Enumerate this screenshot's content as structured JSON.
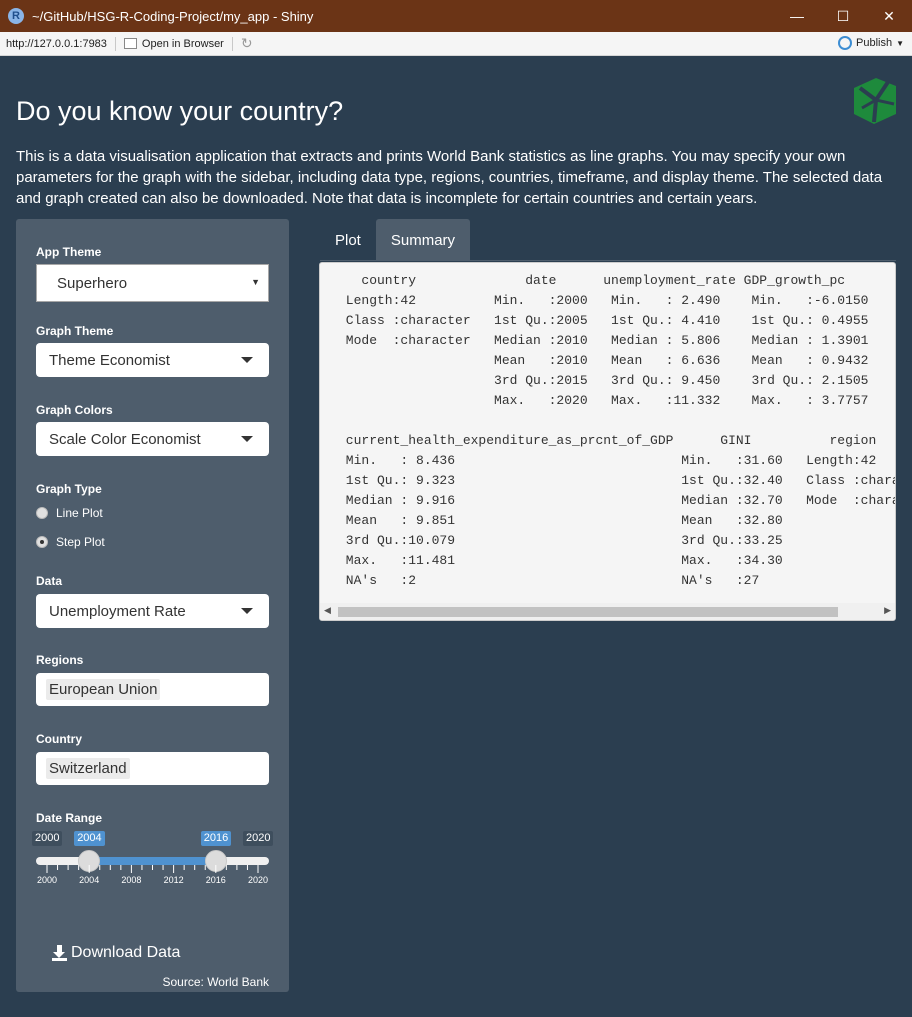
{
  "window": {
    "title": "~/GitHub/HSG-R-Coding-Project/my_app - Shiny",
    "minimize_glyph": "—",
    "maximize_glyph": "☐",
    "close_glyph": "✕"
  },
  "addressbar": {
    "url": "http://127.0.0.1:7983",
    "open_in_browser": "Open in Browser",
    "publish": "Publish"
  },
  "page": {
    "title": "Do you know your country?",
    "intro": "This is a data visualisation application that extracts and prints World Bank statistics as line graphs. You may specify your own parameters for the graph with the sidebar, including data type, regions, countries, timeframe, and display theme. The selected data and graph created can also be downloaded. Note that data is incomplete for certain countries and certain years."
  },
  "sidebar": {
    "app_theme": {
      "label": "App Theme",
      "value": "Superhero"
    },
    "graph_theme": {
      "label": "Graph Theme",
      "value": "Theme Economist"
    },
    "graph_colors": {
      "label": "Graph Colors",
      "value": "Scale Color Economist"
    },
    "graph_type": {
      "label": "Graph Type",
      "options": [
        "Line Plot",
        "Step Plot"
      ],
      "selected": "Step Plot"
    },
    "data": {
      "label": "Data",
      "value": "Unemployment Rate"
    },
    "regions": {
      "label": "Regions",
      "value": "European Union"
    },
    "country": {
      "label": "Country",
      "value": "Switzerland"
    },
    "date_range": {
      "label": "Date Range",
      "min": 2000,
      "max": 2020,
      "from": 2004,
      "to": 2016,
      "min_label": "2000",
      "max_label": "2020",
      "from_label": "2004",
      "to_label": "2016",
      "grid_labels": [
        "2000",
        "2004",
        "2008",
        "2012",
        "2016",
        "2020"
      ]
    },
    "download_label": "Download Data",
    "source": "Source: World Bank"
  },
  "tabs": [
    {
      "label": "Plot",
      "active": false
    },
    {
      "label": "Summary",
      "active": true
    }
  ],
  "summary_output": "   country              date      unemployment_rate GDP_growth_pc    \n Length:42          Min.   :2000   Min.   : 2.490    Min.   :-6.0150  \n Class :character   1st Qu.:2005   1st Qu.: 4.410    1st Qu.: 0.4955  \n Mode  :character   Median :2010   Median : 5.806    Median : 1.3901  \n                    Mean   :2010   Mean   : 6.636    Mean   : 0.9432  \n                    3rd Qu.:2015   3rd Qu.: 9.450    3rd Qu.: 2.1505  \n                    Max.   :2020   Max.   :11.332    Max.   : 3.7757  \n                                                                      \n current_health_expenditure_as_prcnt_of_GDP      GINI          region          \n Min.   : 8.436                             Min.   :31.60   Length:42          \n 1st Qu.: 9.323                             1st Qu.:32.40   Class :character  \n Median : 9.916                             Median :32.70   Mode  :character  \n Mean   : 9.851                             Mean   :32.80                     \n 3rd Qu.:10.079                             3rd Qu.:33.25                     \n Max.   :11.481                             Max.   :34.30                     \n NA's   :2                                  NA's   :27                        ",
  "colors": {
    "background": "#2b3e50",
    "sidebar": "#4e5d6c",
    "accent": "#4f92d0",
    "titlebar": "#6b3416",
    "logo": "#1e8a3c"
  }
}
